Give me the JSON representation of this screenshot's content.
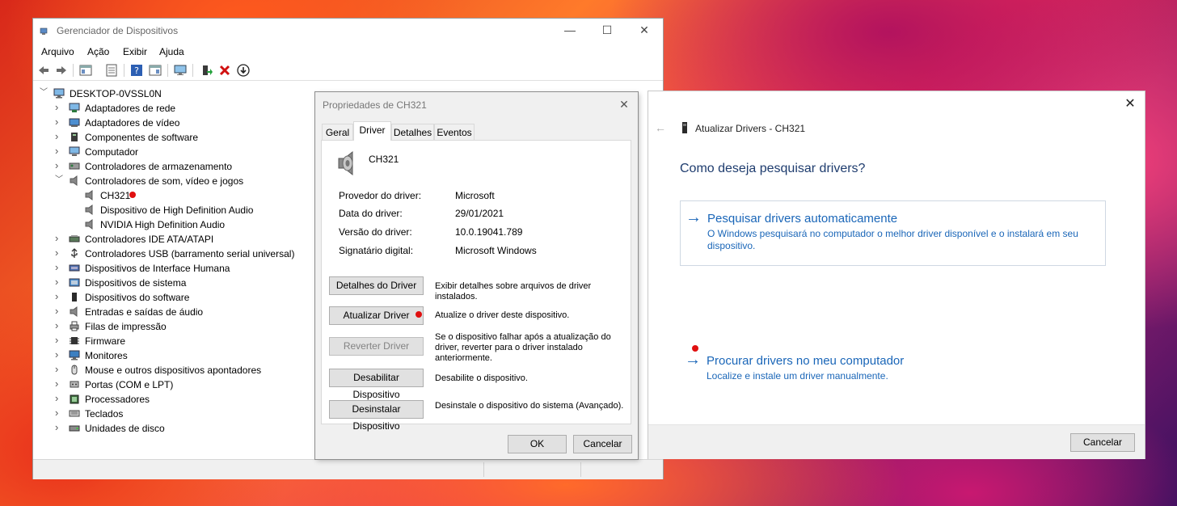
{
  "device_manager": {
    "title": "Gerenciador de Dispositivos",
    "window_controls": {
      "minimize": "—",
      "maximize": "☐",
      "close": "✕"
    },
    "menu": [
      "Arquivo",
      "Ação",
      "Exibir",
      "Ajuda"
    ],
    "root": "DESKTOP-0VSSL0N",
    "categories": [
      {
        "label": "Adaptadores de rede",
        "icon": "network-adapter-icon"
      },
      {
        "label": "Adaptadores de vídeo",
        "icon": "display-adapter-icon"
      },
      {
        "label": "Componentes de software",
        "icon": "software-component-icon"
      },
      {
        "label": "Computador",
        "icon": "computer-icon"
      },
      {
        "label": "Controladores de armazenamento",
        "icon": "storage-controller-icon"
      },
      {
        "label": "Controladores de som, vídeo e jogos",
        "icon": "speaker-icon",
        "expanded": true
      },
      {
        "label": "Controladores IDE ATA/ATAPI",
        "icon": "ide-controller-icon"
      },
      {
        "label": "Controladores USB (barramento serial universal)",
        "icon": "usb-icon"
      },
      {
        "label": "Dispositivos de Interface Humana",
        "icon": "hid-icon"
      },
      {
        "label": "Dispositivos de sistema",
        "icon": "system-device-icon"
      },
      {
        "label": "Dispositivos do software",
        "icon": "software-device-icon"
      },
      {
        "label": "Entradas e saídas de áudio",
        "icon": "audio-io-icon"
      },
      {
        "label": "Filas de impressão",
        "icon": "print-queue-icon"
      },
      {
        "label": "Firmware",
        "icon": "firmware-icon"
      },
      {
        "label": "Monitores",
        "icon": "monitor-icon"
      },
      {
        "label": "Mouse e outros dispositivos apontadores",
        "icon": "mouse-icon"
      },
      {
        "label": "Portas (COM e LPT)",
        "icon": "port-icon"
      },
      {
        "label": "Processadores",
        "icon": "processor-icon"
      },
      {
        "label": "Teclados",
        "icon": "keyboard-icon"
      },
      {
        "label": "Unidades de disco",
        "icon": "disk-drive-icon"
      }
    ],
    "sound_children": [
      "CH321",
      "Dispositivo de High Definition Audio",
      "NVIDIA High Definition Audio"
    ]
  },
  "properties": {
    "title": "Propriedades de CH321",
    "close": "✕",
    "tabs": [
      "Geral",
      "Driver",
      "Detalhes",
      "Eventos"
    ],
    "active_tab": "Driver",
    "device_name": "CH321",
    "info": [
      {
        "key": "Provedor do driver:",
        "value": "Microsoft"
      },
      {
        "key": "Data do driver:",
        "value": "29/01/2021"
      },
      {
        "key": "Versão do driver:",
        "value": "10.0.19041.789"
      },
      {
        "key": "Signatário digital:",
        "value": "Microsoft Windows"
      }
    ],
    "buttons": [
      {
        "label": "Detalhes do Driver",
        "desc": "Exibir detalhes sobre arquivos de driver instalados.",
        "enabled": true
      },
      {
        "label": "Atualizar Driver",
        "desc": "Atualize o driver deste dispositivo.",
        "enabled": true
      },
      {
        "label": "Reverter Driver",
        "desc": "Se o dispositivo falhar após a atualização do driver, reverter para o driver instalado anteriormente.",
        "enabled": false
      },
      {
        "label": "Desabilitar Dispositivo",
        "desc": "Desabilite o dispositivo.",
        "enabled": true
      },
      {
        "label": "Desinstalar Dispositivo",
        "desc": "Desinstale o dispositivo do sistema (Avançado).",
        "enabled": true
      }
    ],
    "ok": "OK",
    "cancel": "Cancelar"
  },
  "update_drivers": {
    "close": "✕",
    "back": "←",
    "header": "Atualizar Drivers - CH321",
    "question": "Como deseja pesquisar drivers?",
    "options": [
      {
        "title": "Pesquisar drivers automaticamente",
        "desc": "O Windows pesquisará no computador o melhor driver disponível e o instalará em seu dispositivo."
      },
      {
        "title": "Procurar drivers no meu computador",
        "desc": "Localize e instale um driver manualmente."
      }
    ],
    "cancel": "Cancelar"
  },
  "colors": {
    "accent": "#1a66b8",
    "marker": "#e01010"
  }
}
